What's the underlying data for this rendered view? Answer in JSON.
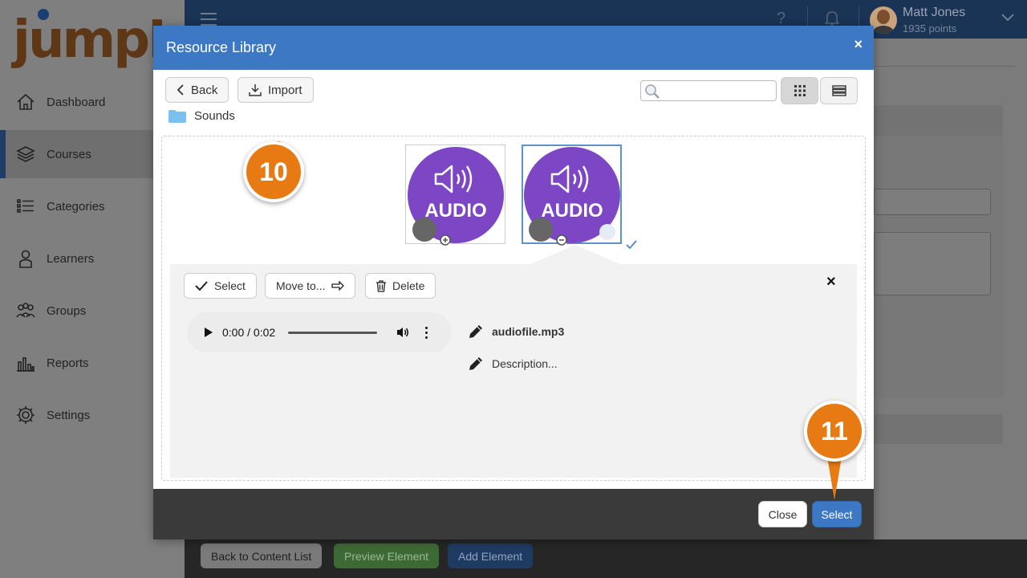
{
  "brand": {
    "logo_text": "jumpIn"
  },
  "sidebar": {
    "items": [
      {
        "label": "Dashboard",
        "icon": "home-icon"
      },
      {
        "label": "Courses",
        "icon": "books-icon",
        "active": true
      },
      {
        "label": "Categories",
        "icon": "list-icon"
      },
      {
        "label": "Learners",
        "icon": "person-icon"
      },
      {
        "label": "Groups",
        "icon": "group-icon"
      },
      {
        "label": "Reports",
        "icon": "bar-chart-icon"
      },
      {
        "label": "Settings",
        "icon": "gear-icon"
      }
    ]
  },
  "topbar": {
    "user_name": "Matt Jones",
    "user_points": "1935 points"
  },
  "bottom_bar": {
    "back_label": "Back to Content List",
    "preview_label": "Preview Element",
    "add_label": "Add Element"
  },
  "modal": {
    "title": "Resource Library",
    "close_glyph": "×",
    "toolbar": {
      "back_label": "Back",
      "import_label": "Import",
      "search_placeholder": "",
      "search_value": ""
    },
    "folder": "Sounds",
    "files": [
      {
        "label": "AUDIO",
        "icon": "speaker-icon",
        "selected": false
      },
      {
        "label": "AUDIO",
        "icon": "speaker-icon",
        "selected": true
      }
    ],
    "detail": {
      "select_label": "Select",
      "move_label": "Move to...",
      "delete_label": "Delete",
      "close_glyph": "×",
      "player_time": "0:00 / 0:02",
      "file_name": "audiofile.mp3",
      "description": "Description..."
    },
    "footer": {
      "close_label": "Close",
      "select_label": "Select"
    }
  },
  "callouts": {
    "step_a": "10",
    "step_b": "11"
  },
  "colors": {
    "modal_header": "#3c78c3",
    "audio_purple": "#7c46c5",
    "callout_orange": "#e87a13",
    "topbar": "#1a3456"
  }
}
